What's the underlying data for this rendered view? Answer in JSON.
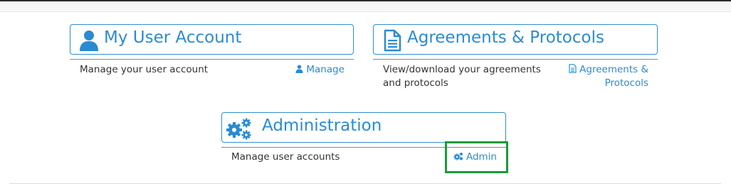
{
  "panels": {
    "account": {
      "title": "My User Account",
      "description": "Manage your user account",
      "link_label": "Manage"
    },
    "agreements": {
      "title": "Agreements & Protocols",
      "description_line1": "View/download your agreements",
      "description_line2": "and protocols",
      "link_line1": "Agreements &",
      "link_line2": "Protocols"
    },
    "administration": {
      "title": "Administration",
      "description": "Manage user accounts",
      "link_label": "Admin"
    }
  },
  "icons": {
    "account": "user-icon",
    "agreements": "document-icon",
    "administration": "cogs-icon"
  },
  "colors": {
    "accent": "#2a8bd2",
    "highlight": "#1a9b3a"
  }
}
